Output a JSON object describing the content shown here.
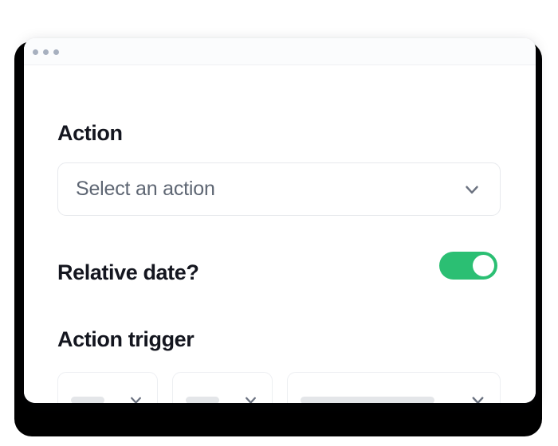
{
  "window": {
    "chrome": {
      "dots": [
        "dot-red",
        "dot-yellow",
        "dot-green"
      ],
      "dot_color": "#a7b0bf"
    }
  },
  "form": {
    "sections": [
      {
        "heading": "Action",
        "control": {
          "type": "select",
          "placeholder": "Select an action",
          "value": "",
          "icon": "chevron-down-icon"
        }
      },
      {
        "heading": "Relative date?",
        "control": {
          "type": "toggle",
          "state": "on",
          "on_color": "#2bbf73",
          "knob_color": "#ffffff"
        }
      },
      {
        "heading": "Action trigger",
        "control": {
          "type": "select-group",
          "items": [
            {
              "value": "",
              "loading": true,
              "icon": "chevron-down-icon"
            },
            {
              "value": "",
              "loading": true,
              "icon": "chevron-down-icon"
            },
            {
              "value": "",
              "loading": true,
              "icon": "chevron-down-icon"
            }
          ]
        }
      }
    ]
  },
  "colors": {
    "backdrop": "#000000",
    "surface": "#ffffff",
    "chrome_bg": "#fbfcfd",
    "heading_text": "#14161f",
    "placeholder_text": "#5e6673",
    "border": "#e7e9ed",
    "skeleton": "#e4e6e9",
    "accent_green": "#2bbf73",
    "chevron": "#6b7280"
  }
}
